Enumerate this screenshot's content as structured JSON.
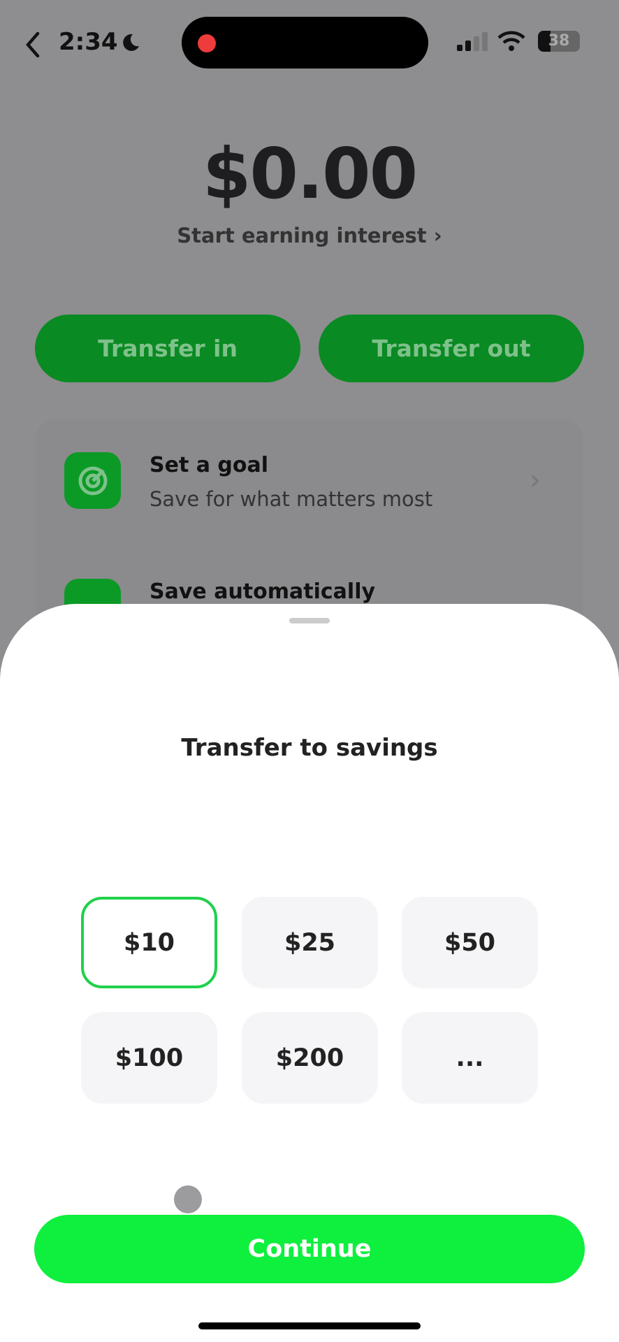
{
  "status_bar": {
    "time": "2:34",
    "battery": "38",
    "icons": [
      "back-chevron-icon",
      "moon-icon",
      "signal-icon",
      "wifi-icon",
      "battery-icon"
    ]
  },
  "savings": {
    "balance": "$0.00",
    "interest_link": "Start earning interest"
  },
  "actions": {
    "transfer_in": "Transfer in",
    "transfer_out": "Transfer out"
  },
  "list": [
    {
      "title": "Set a goal",
      "subtitle": "Save for what matters most",
      "icon": "target-icon"
    },
    {
      "title": "Save automatically",
      "icon": "auto-save-icon"
    }
  ],
  "sheet": {
    "title": "Transfer to savings",
    "amounts": [
      "$10",
      "$25",
      "$50",
      "$100",
      "$200",
      "..."
    ],
    "selected": "$10",
    "continue_label": "Continue"
  },
  "colors": {
    "accent": "#0fef3e",
    "selected_border": "#1fd14a",
    "dimmed_green": "#0a8a22"
  }
}
